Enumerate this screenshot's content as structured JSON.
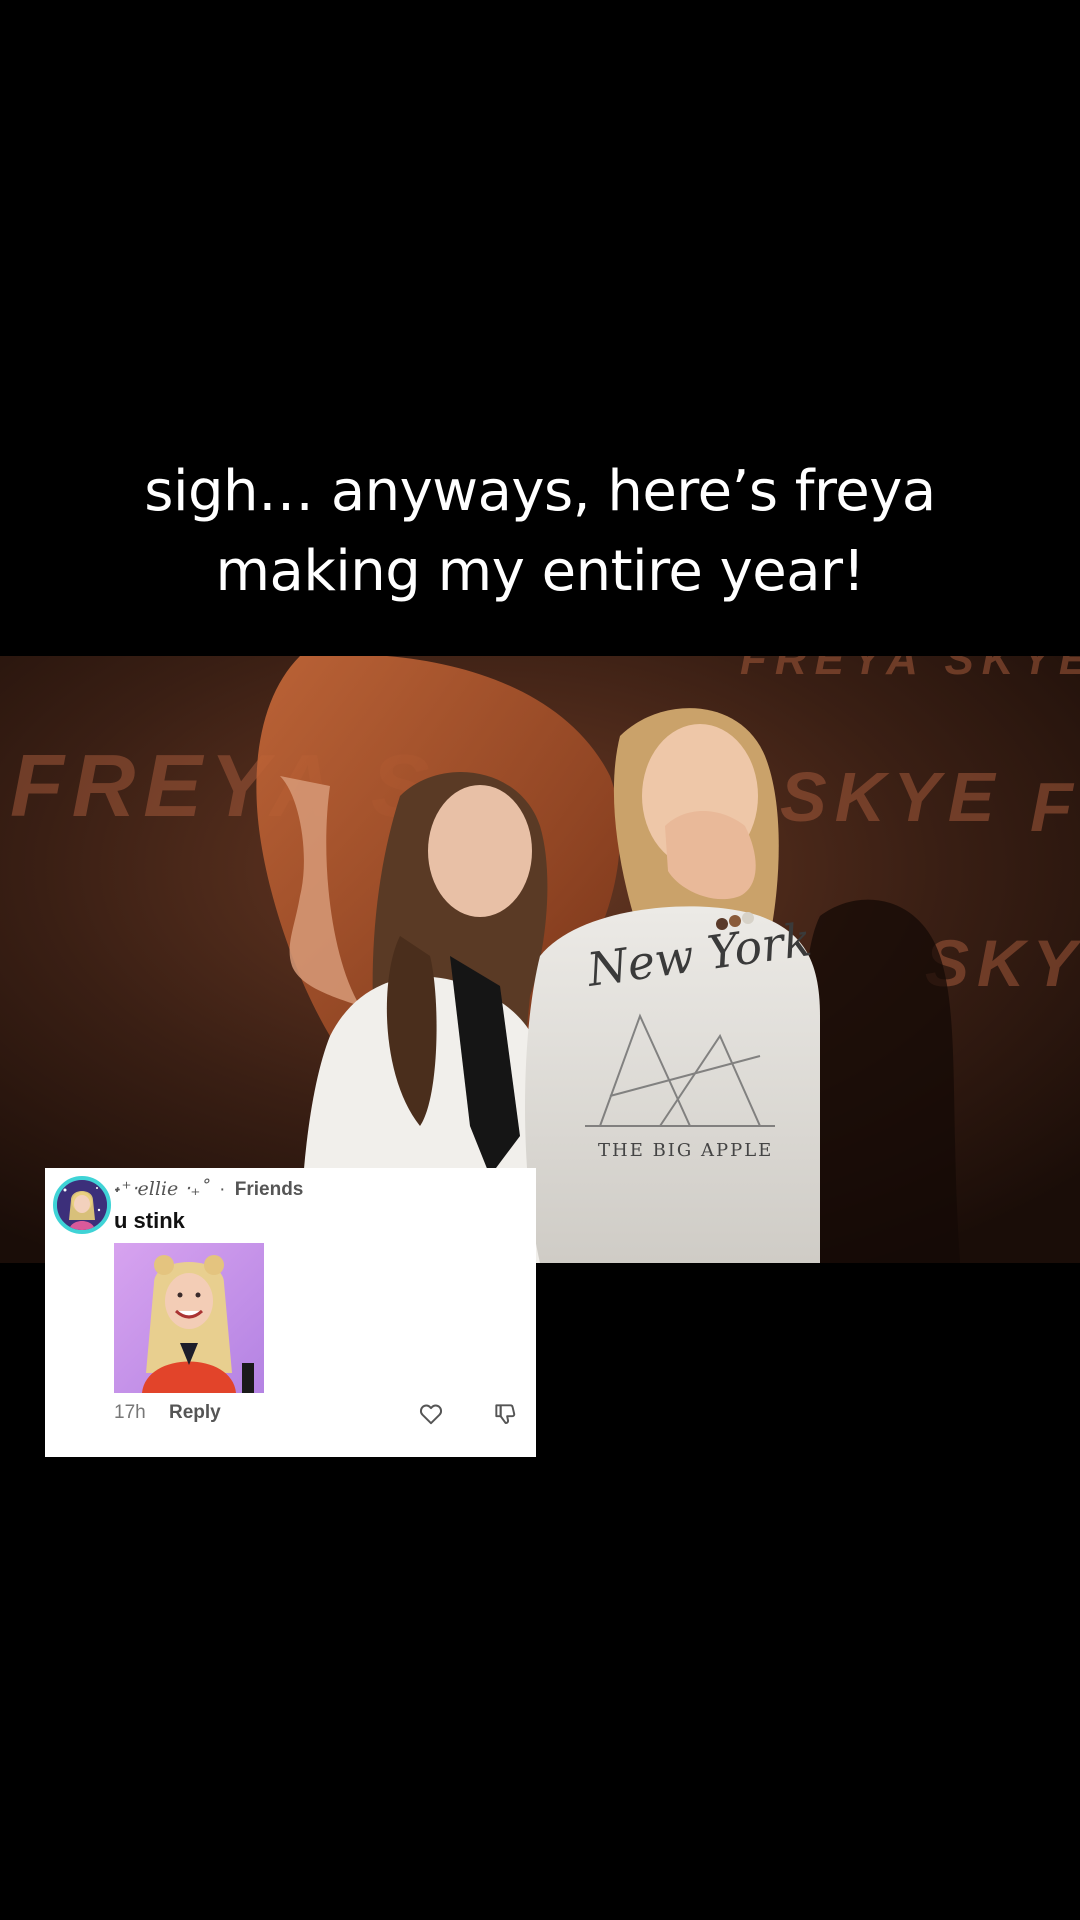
{
  "caption": {
    "line1": "sigh… anyways, here’s freya",
    "line2": "making my entire year!"
  },
  "video": {
    "banner_words": [
      "FREYA S",
      "SKYE",
      "SKYE",
      "FREYA SKYE",
      "F"
    ],
    "shirt_text": "New York",
    "shirt_subtext": "THE BIG APPLE"
  },
  "comment": {
    "username": "˖⁺‧ellie ‧₊˚",
    "separator": "·",
    "relationship": "Friends",
    "text": "u stink",
    "time": "17h",
    "reply_label": "Reply",
    "like_icon": "heart-icon",
    "dislike_icon": "thumbs-down-icon"
  },
  "colors": {
    "background": "#000000",
    "caption_text": "#ffffff",
    "avatar_ring": "#3fd3d6",
    "card_bg": "#ffffff"
  }
}
